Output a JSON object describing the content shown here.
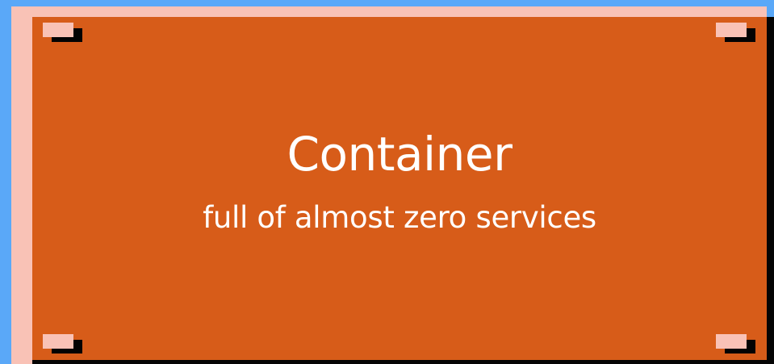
{
  "container": {
    "title": "Container",
    "subtitle": "full of almost zero services"
  },
  "colors": {
    "background": "#5aa8f8",
    "frame": "#f9c2b6",
    "container_fill": "#d75c19",
    "shadow": "#050505",
    "text": "#ffffff"
  }
}
